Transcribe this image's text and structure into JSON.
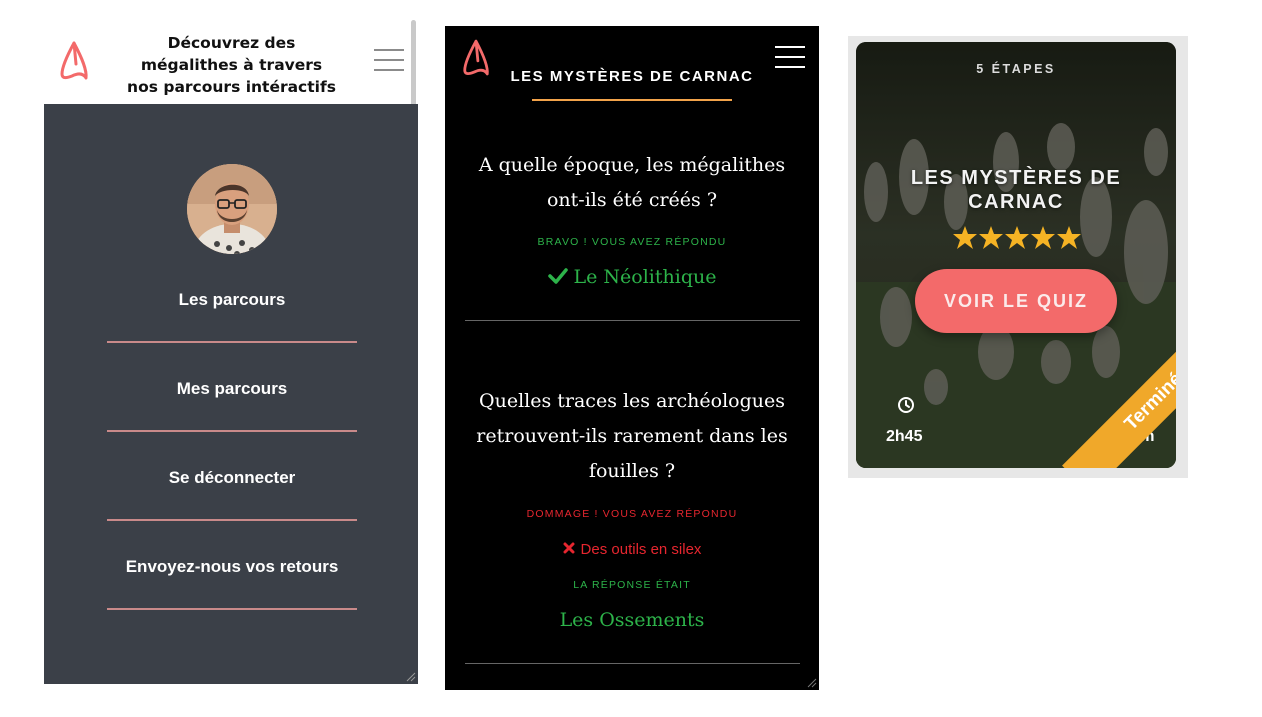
{
  "menu_panel": {
    "tagline": "Découvrez des mégalithes à travers nos parcours intéractifs",
    "items": [
      {
        "label": "Les parcours"
      },
      {
        "label": "Mes parcours"
      },
      {
        "label": "Se déconnecter"
      },
      {
        "label": "Envoyez-nous vos retours"
      }
    ],
    "colors": {
      "menu_bg": "#3b4048",
      "divider": "#c98a8a",
      "logo": "#f36a6a"
    }
  },
  "quiz_panel": {
    "title": "LES MYSTÈRES DE CARNAC",
    "questions": [
      {
        "question": "A quelle époque, les mégalithes ont-ils été créés ?",
        "status": "BRAVO ! VOUS AVEZ RÉPONDU",
        "answer": "Le Néolithique"
      },
      {
        "question": "Quelles traces les archéologues retrouvent-ils rarement dans les fouilles ?",
        "status": "DOMMAGE ! VOUS AVEZ RÉPONDU",
        "answer": "Des outils en silex",
        "correct_label": "LA RÉPONSE ÉTAIT",
        "correct_answer": "Les Ossements"
      }
    ],
    "colors": {
      "accent": "#f2a34a",
      "success": "#2db34a",
      "error": "#e6262f"
    }
  },
  "card": {
    "steps": "5 ÉTAPES",
    "title": "LES MYSTÈRES DE CARNAC",
    "rating": 5,
    "button_label": "VOIR LE QUIZ",
    "duration": "2h45",
    "distance": "7 km",
    "ribbon": "Terminé",
    "colors": {
      "button": "#f36a6a",
      "ribbon": "#f0a82a",
      "star": "#f5b324"
    }
  }
}
